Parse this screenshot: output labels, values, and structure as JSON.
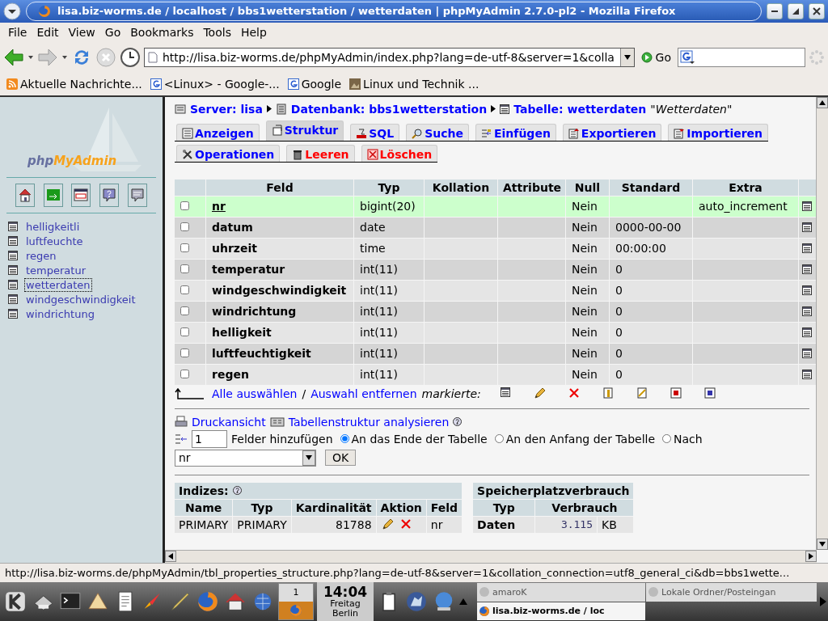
{
  "window": {
    "title": "lisa.biz-worms.de / localhost / bbs1wetterstation  / wetterdaten | phpMyAdmin 2.7.0-pl2 - Mozilla Firefox"
  },
  "menu": [
    "File",
    "Edit",
    "View",
    "Go",
    "Bookmarks",
    "Tools",
    "Help"
  ],
  "navigation": {
    "url": "http://lisa.biz-worms.de/phpMyAdmin/index.php?lang=de-utf-8&server=1&colla",
    "go": "Go"
  },
  "bookmarks": [
    {
      "label": "Aktuelle Nachrichte...",
      "kind": "feed"
    },
    {
      "label": "<Linux> - Google-...",
      "kind": "google"
    },
    {
      "label": "Google",
      "kind": "google"
    },
    {
      "label": "Linux und Technik ...",
      "kind": "image"
    }
  ],
  "sidebar": {
    "logo": "php**MyAdmin**",
    "tables": [
      {
        "name": "helligkeitli",
        "selected": false
      },
      {
        "name": "luftfeuchte",
        "selected": false
      },
      {
        "name": "regen",
        "selected": false
      },
      {
        "name": "temperatur",
        "selected": false
      },
      {
        "name": "wetterdaten",
        "selected": true
      },
      {
        "name": "windgeschwindigkeit",
        "selected": false
      },
      {
        "name": "windrichtung",
        "selected": false
      }
    ]
  },
  "breadcrumb": {
    "server": "Server: lisa",
    "database": "Datenbank: bbs1wetterstation",
    "table": "Tabelle: wetterdaten",
    "comment": "\"Wetterdaten\""
  },
  "tab_rows": [
    [
      {
        "label": "Anzeigen",
        "selected": false,
        "kind": "normal"
      },
      {
        "label": "Struktur",
        "selected": true,
        "kind": "normal"
      },
      {
        "label": "SQL",
        "selected": false,
        "kind": "normal"
      },
      {
        "label": "Suche",
        "selected": false,
        "kind": "normal"
      },
      {
        "label": "Einfügen",
        "selected": false,
        "kind": "normal"
      },
      {
        "label": "Exportieren",
        "selected": false,
        "kind": "normal"
      },
      {
        "label": "Importieren",
        "selected": false,
        "kind": "normal"
      }
    ],
    [
      {
        "label": "Operationen",
        "selected": false,
        "kind": "normal"
      },
      {
        "label": "Leeren",
        "selected": false,
        "kind": "danger"
      },
      {
        "label": "Löschen",
        "selected": false,
        "kind": "danger"
      }
    ]
  ],
  "table": {
    "columns": [
      "Feld",
      "Typ",
      "Kollation",
      "Attribute",
      "Null",
      "Standard",
      "Extra"
    ],
    "rows": [
      {
        "checked": false,
        "highlighted": true,
        "primary": true,
        "field": "nr",
        "type": "bigint(20)",
        "null": "Nein",
        "extra": "auto_increment"
      },
      {
        "checked": false,
        "highlighted": false,
        "primary": false,
        "field": "datum",
        "type": "date",
        "null": "Nein",
        "default": "0000-00-00"
      },
      {
        "checked": false,
        "highlighted": false,
        "primary": false,
        "field": "uhrzeit",
        "type": "time",
        "null": "Nein",
        "default": "00:00:00"
      },
      {
        "checked": false,
        "highlighted": false,
        "primary": false,
        "field": "temperatur",
        "type": "int(11)",
        "null": "Nein",
        "default": "0"
      },
      {
        "checked": false,
        "highlighted": false,
        "primary": false,
        "field": "windgeschwindigkeit",
        "type": "int(11)",
        "null": "Nein",
        "default": "0"
      },
      {
        "checked": false,
        "highlighted": false,
        "primary": false,
        "field": "windrichtung",
        "type": "int(11)",
        "null": "Nein",
        "default": "0"
      },
      {
        "checked": false,
        "highlighted": false,
        "primary": false,
        "field": "helligkeit",
        "type": "int(11)",
        "null": "Nein",
        "default": "0"
      },
      {
        "checked": false,
        "highlighted": false,
        "primary": false,
        "field": "luftfeuchtigkeit",
        "type": "int(11)",
        "null": "Nein",
        "default": "0"
      },
      {
        "checked": false,
        "highlighted": false,
        "primary": false,
        "field": "regen",
        "type": "int(11)",
        "null": "Nein",
        "default": "0"
      }
    ]
  },
  "selection": {
    "check_all": "Alle auswählen",
    "separator": "/",
    "uncheck_all": "Auswahl entfernen",
    "with_selected": "markierte:"
  },
  "links": {
    "print": "Druckansicht",
    "analyze": "Tabellenstruktur analysieren"
  },
  "add_fields": {
    "count": "1",
    "label": "Felder hinzufügen",
    "positions": [
      {
        "label": "An das Ende der Tabelle",
        "selected": true
      },
      {
        "label": "An den Anfang der Tabelle",
        "selected": false
      },
      {
        "label": "Nach",
        "selected": false
      }
    ],
    "after_field": "nr",
    "ok": "OK"
  },
  "indexes": {
    "title": "Indizes:",
    "columns": [
      "Name",
      "Typ",
      "Kardinalität",
      "Aktion",
      "Feld"
    ],
    "rows": [
      {
        "name": "PRIMARY",
        "type": "PRIMARY",
        "cardinality": "81788",
        "field": "nr"
      }
    ]
  },
  "storage": {
    "title": "Speicherplatzverbrauch",
    "columns": [
      "Typ",
      "Verbrauch"
    ],
    "rows": [
      {
        "label": "Daten",
        "value": "3.115",
        "unit": "KB"
      }
    ]
  },
  "status_bar": "http://lisa.biz-worms.de/phpMyAdmin/tbl_properties_structure.php?lang=de-utf-8&server=1&collation_connection=utf8_general_ci&db=bbs1wette...",
  "taskbar": {
    "desktop": "1",
    "clock": "14:04",
    "day": "Freitag",
    "place": "Berlin",
    "tasks": [
      {
        "label": "amaroK",
        "selected": false
      },
      {
        "label": "Lokale Ordner/Posteingan",
        "selected": false
      },
      {
        "label": "lisa.biz-worms.de / loc",
        "selected": true
      }
    ]
  }
}
